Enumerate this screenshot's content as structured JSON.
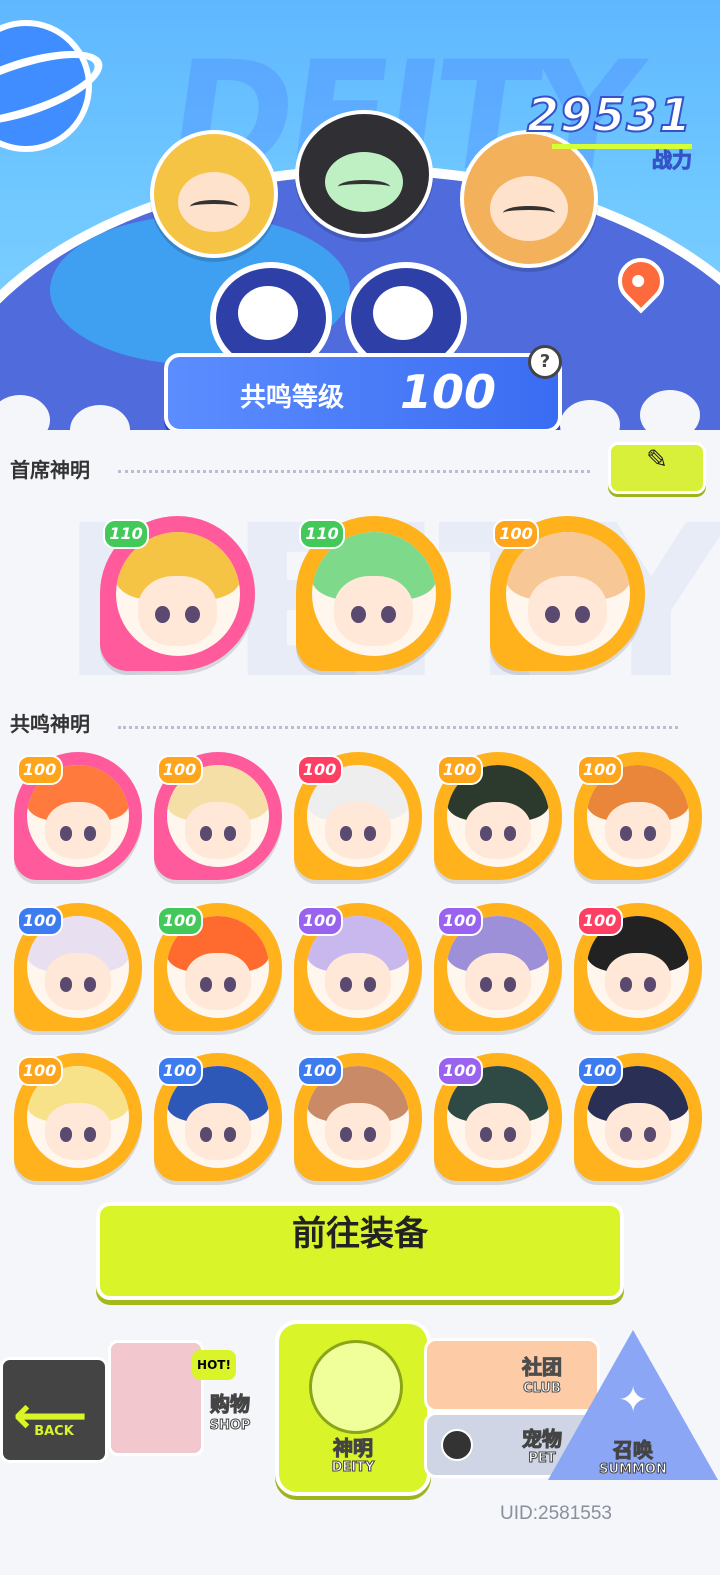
{
  "hero": {
    "bg_word": "DEITY",
    "power_value": "29531",
    "power_label": "战力",
    "resonance_label": "共鸣等级",
    "resonance_level": "100",
    "help_glyph": "?"
  },
  "chief_section": {
    "title": "首席神明",
    "edit_icon": "✎",
    "cards": [
      {
        "level": "110",
        "frame": "pink",
        "badge": "green",
        "hair": "#f6c445"
      },
      {
        "level": "110",
        "frame": "gold",
        "badge": "green",
        "hair": "#7ed98b"
      },
      {
        "level": "100",
        "frame": "gold",
        "badge": "orange",
        "hair": "#f7c896"
      }
    ]
  },
  "resonance_section": {
    "title": "共鸣神明",
    "cards": [
      {
        "level": "100",
        "frame": "pink",
        "badge": "orange",
        "hair": "#ff7a3c"
      },
      {
        "level": "100",
        "frame": "pink",
        "badge": "orange",
        "hair": "#f5dfa6"
      },
      {
        "level": "100",
        "frame": "gold",
        "badge": "red",
        "hair": "#eeeeee"
      },
      {
        "level": "100",
        "frame": "gold",
        "badge": "orange",
        "hair": "#2b3a2c"
      },
      {
        "level": "100",
        "frame": "gold",
        "badge": "orange",
        "hair": "#e9863a"
      },
      {
        "level": "100",
        "frame": "gold",
        "badge": "blue",
        "hair": "#e8dff0"
      },
      {
        "level": "100",
        "frame": "gold",
        "badge": "green",
        "hair": "#ff6b2e"
      },
      {
        "level": "100",
        "frame": "gold",
        "badge": "purple",
        "hair": "#c8b8ee"
      },
      {
        "level": "100",
        "frame": "gold",
        "badge": "purple",
        "hair": "#9d8fd8"
      },
      {
        "level": "100",
        "frame": "gold",
        "badge": "red",
        "hair": "#222222"
      },
      {
        "level": "100",
        "frame": "gold",
        "badge": "orange",
        "hair": "#f7e28a"
      },
      {
        "level": "100",
        "frame": "gold",
        "badge": "blue",
        "hair": "#2d58b8"
      },
      {
        "level": "100",
        "frame": "gold",
        "badge": "blue",
        "hair": "#c98a68"
      },
      {
        "level": "100",
        "frame": "gold",
        "badge": "purple",
        "hair": "#2f4a44"
      },
      {
        "level": "100",
        "frame": "gold",
        "badge": "blue",
        "hair": "#2a2f55"
      }
    ]
  },
  "equip_button": "前往装备",
  "nav": {
    "back_label": "BACK",
    "back_arrow": "⟵",
    "shop_label": "购物",
    "shop_sub": "SHOP",
    "shop_hot": "HOT!",
    "deity_label": "神明",
    "deity_sub": "DEITY",
    "club_label": "社团",
    "club_sub": "CLUB",
    "pet_label": "宠物",
    "pet_sub": "PET",
    "summon_label": "召唤",
    "summon_sub": "SUMMON",
    "summon_star": "✦"
  },
  "uid": "UID:2581553"
}
